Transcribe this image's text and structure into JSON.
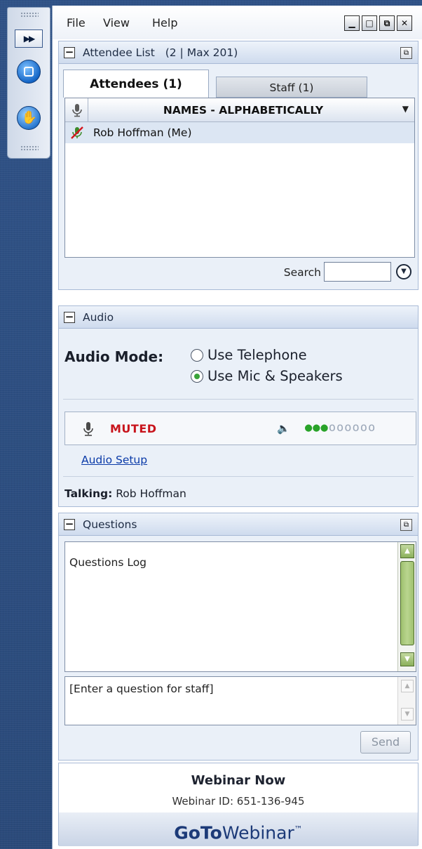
{
  "menubar": {
    "items": [
      "File",
      "View",
      "Help"
    ]
  },
  "attendee_panel": {
    "title": "Attendee List",
    "count": "(2 | Max 201)",
    "tabs": [
      {
        "label": "Attendees (1)",
        "active": true
      },
      {
        "label": "Staff (1)",
        "active": false
      }
    ],
    "column_header": "NAMES - ALPHABETICALLY",
    "attendees": [
      {
        "name": "Rob Hoffman (Me)",
        "status": "mic-muted-icon"
      }
    ],
    "search_label": "Search",
    "search_value": ""
  },
  "audio_panel": {
    "title": "Audio",
    "mode_label": "Audio Mode:",
    "options": [
      {
        "label": "Use Telephone",
        "selected": false
      },
      {
        "label": "Use Mic & Speakers",
        "selected": true
      }
    ],
    "mic_status": "MUTED",
    "speaker_level": {
      "lit": 3,
      "total": 9
    },
    "setup_link": "Audio Setup",
    "talking_label": "Talking:",
    "talking_name": "Rob Hoffman"
  },
  "questions_panel": {
    "title": "Questions",
    "log_label": "Questions Log",
    "input_placeholder": "[Enter a question for staff]",
    "send_label": "Send"
  },
  "footer": {
    "event_name": "Webinar Now",
    "webinar_id": "Webinar ID: 651-136-945",
    "brand_bold": "GoTo",
    "brand_rest": "Webinar",
    "brand_tm": "™"
  },
  "colors": {
    "muted": "#c8141c",
    "level_on": "#29a329",
    "link": "#0a3aa8",
    "scroll_green": "#8bb05a"
  }
}
